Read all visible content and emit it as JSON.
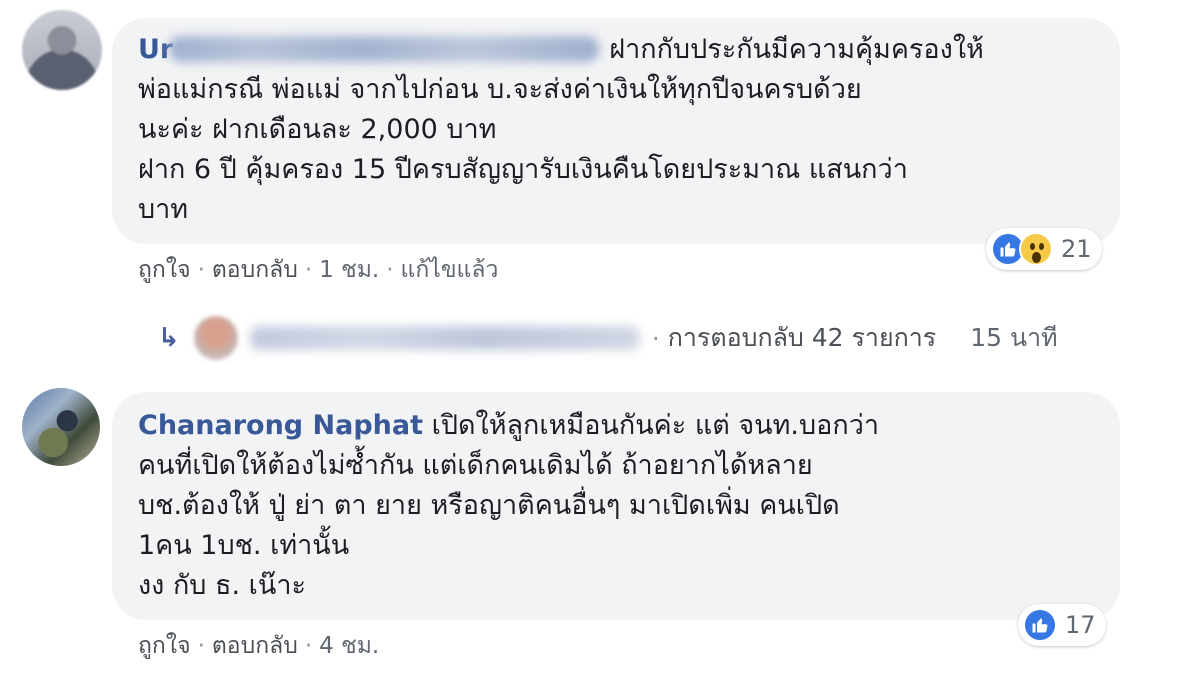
{
  "comments": [
    {
      "author": "Ur",
      "text_first_line_tail": "ฝากกับประกันมีความคุ้มครองให้",
      "text_rest": "พ่อแม่กรณี พ่อแม่ จากไปก่อน บ.จะส่งค่าเงินให้ทุกปีจนครบด้วย\nนะค่ะ ฝากเดือนละ 2,000 บาท\nฝาก 6 ปี คุ้มครอง 15 ปีครบสัญญารับเงินคืนโดยประมาณ แสนกว่า\nบาท",
      "actions": {
        "like": "ถูกใจ",
        "reply": "ตอบกลับ",
        "time": "1 ชม.",
        "edited": "แก้ไขแล้ว"
      },
      "reactions": {
        "icons": [
          "like-icon",
          "wow-icon"
        ],
        "count": "21"
      }
    },
    {
      "author": "Chanarong Naphat",
      "text": "เปิดให้ลูกเหมือนกันค่ะ แต่ จนท.บอกว่า\nคนที่เปิดให้ต้องไม่ซ้ำกัน แต่เด็กคนเดิมได้ ถ้าอยากได้หลาย\nบช.ต้องให้ ปู่ ย่า ตา ยาย หรือญาติคนอื่นๆ มาเปิดเพิ่ม คนเปิด\n1คน 1บช. เท่านั้น\nงง กับ ธ. เน๊าะ",
      "actions": {
        "like": "ถูกใจ",
        "reply": "ตอบกลับ",
        "time": "4 ชม."
      },
      "reactions": {
        "icons": [
          "like-icon"
        ],
        "count": "17"
      }
    }
  ],
  "reply_summary": {
    "arrow": "↳",
    "label": "การตอบกลับ 42 รายการ",
    "time": "15 นาที"
  },
  "separator": "·",
  "colors": {
    "author": "#385898",
    "bubble": "#f2f3f5",
    "like": "#3578e5",
    "wow": "#f7c948",
    "meta": "#606770"
  }
}
